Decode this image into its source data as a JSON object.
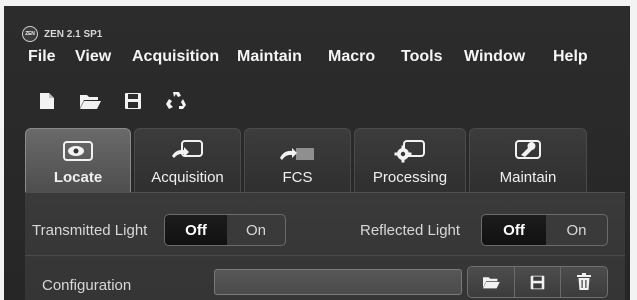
{
  "window": {
    "logo_text": "ZEN",
    "title": "ZEN 2.1 SP1"
  },
  "menu": [
    "File",
    "View",
    "Acquisition",
    "Maintain",
    "Macro",
    "Tools",
    "Window",
    "Help"
  ],
  "toolbar": {
    "icons": [
      "new-document-icon",
      "open-folder-icon",
      "save-icon",
      "recycle-icon"
    ]
  },
  "tabs": [
    {
      "label": "Locate",
      "icon": "eye-icon",
      "active": true
    },
    {
      "label": "Acquisition",
      "icon": "acquisition-icon",
      "active": false
    },
    {
      "label": "FCS",
      "icon": "fcs-icon",
      "active": false
    },
    {
      "label": "Processing",
      "icon": "gear-icon",
      "active": false
    },
    {
      "label": "Maintain",
      "icon": "wrench-icon",
      "active": false
    }
  ],
  "panel": {
    "transmitted": {
      "label": "Transmitted Light",
      "off": "Off",
      "on": "On",
      "selected": "Off"
    },
    "reflected": {
      "label": "Reflected Light",
      "off": "Off",
      "on": "On",
      "selected": "Off"
    },
    "configuration": {
      "label": "Configuration",
      "value": "",
      "buttons": [
        "open-folder-icon",
        "save-icon",
        "delete-icon"
      ]
    }
  }
}
